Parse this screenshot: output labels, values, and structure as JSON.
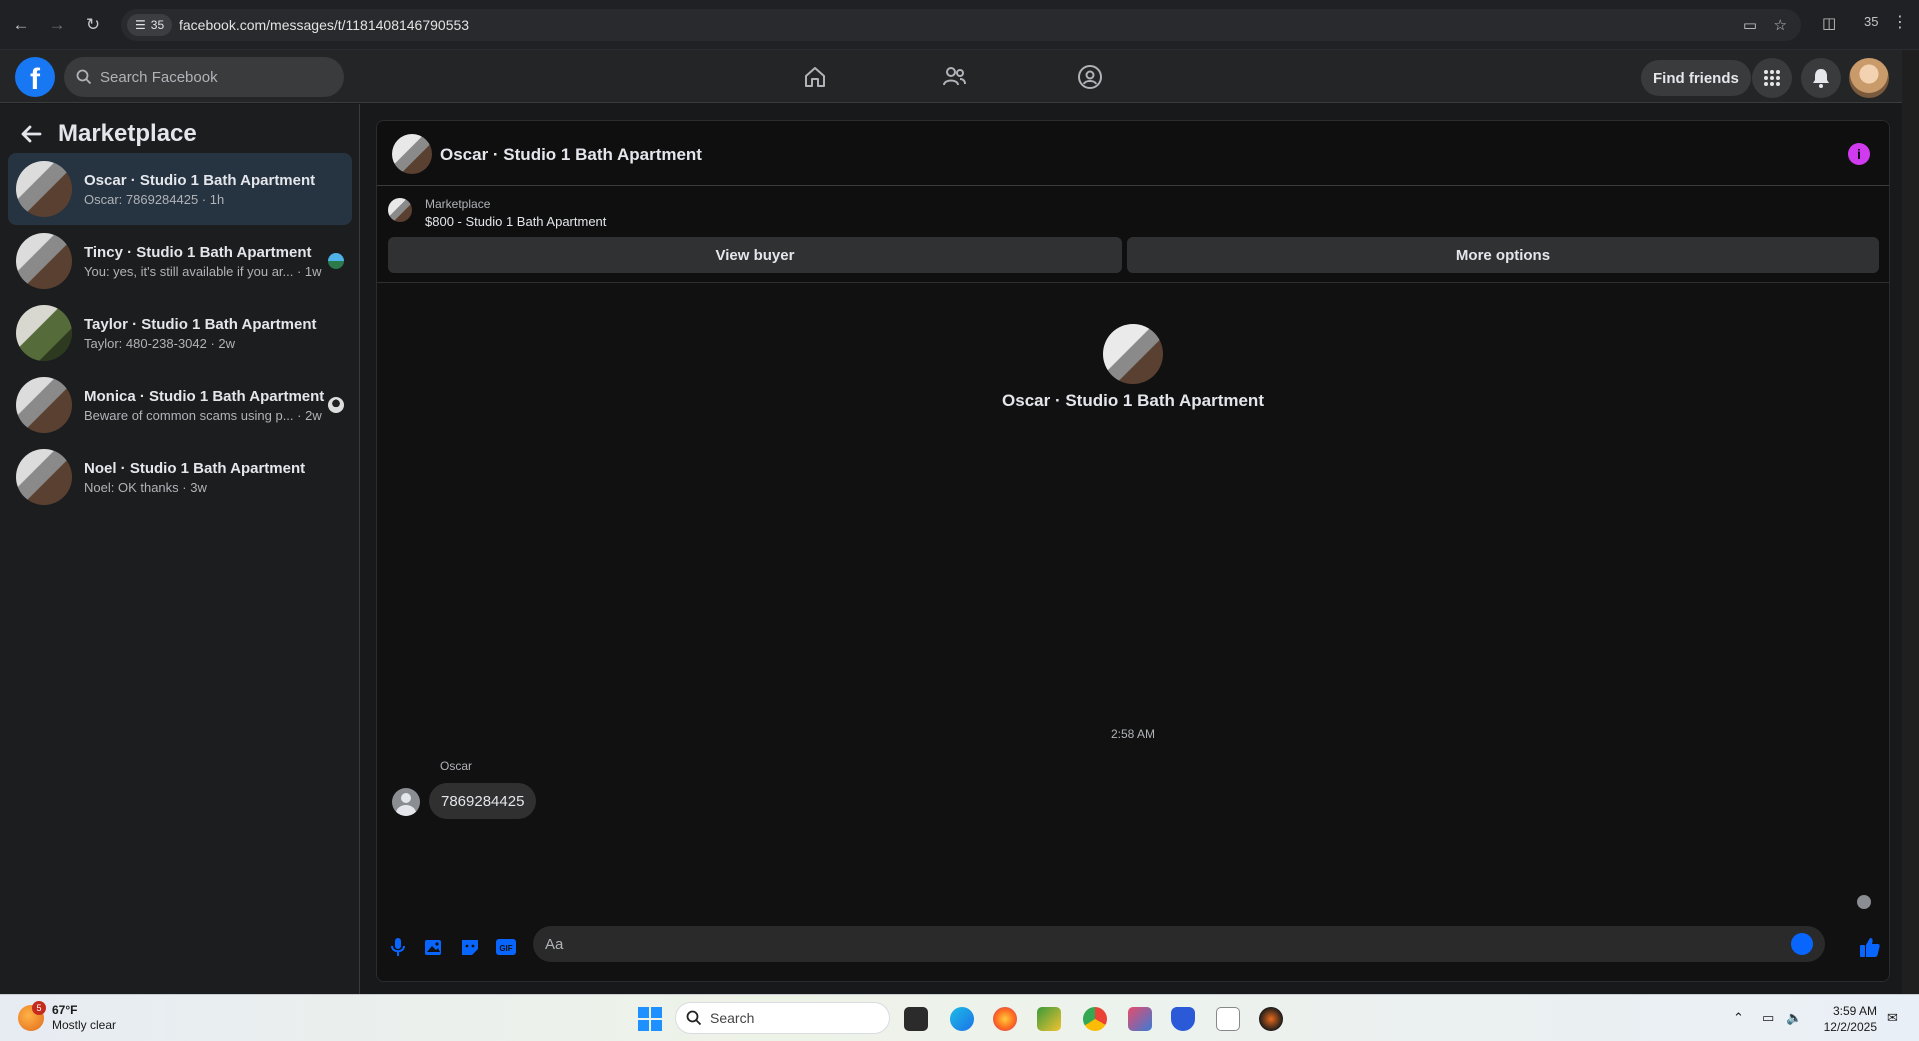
{
  "browser": {
    "tab_count": "35",
    "url": "facebook.com/messages/t/1181408146790553",
    "right_counter": "35"
  },
  "fb_nav": {
    "logo": "f",
    "search_placeholder": "Search Facebook",
    "find_friends": "Find friends"
  },
  "sidebar": {
    "title": "Marketplace",
    "conversations": [
      {
        "name": "Oscar · Studio 1 Bath Apartment",
        "preview": "Oscar: 7869284425 · 1h",
        "active": true
      },
      {
        "name": "Tincy · Studio 1 Bath Apartment",
        "preview": "You: yes, it's still available if you ar... · 1w"
      },
      {
        "name": "Taylor · Studio 1 Bath Apartment",
        "preview": "Taylor: 480-238-3042 · 2w"
      },
      {
        "name": "Monica · Studio 1 Bath Apartment",
        "preview": "Beware of common scams using p... · 2w"
      },
      {
        "name": "Noel · Studio 1 Bath Apartment",
        "preview": "Noel: OK thanks · 3w"
      }
    ]
  },
  "chat": {
    "title": "Oscar · Studio 1 Bath Apartment",
    "info_icon": "i",
    "listing_label": "Marketplace",
    "listing_price_title": "$800 - Studio 1 Bath Apartment",
    "view_buyer": "View buyer",
    "more_options": "More options",
    "intro_name": "Oscar · Studio 1 Bath Apartment",
    "timestamp": "2:58 AM",
    "sender": "Oscar",
    "message": "7869284425",
    "composer_placeholder": "Aa",
    "gif_label": "GIF"
  },
  "taskbar": {
    "weather_badge": "5",
    "weather_temp": "67°F",
    "weather_desc": "Mostly clear",
    "search_label": "Search",
    "time": "3:59 AM",
    "date": "12/2/2025"
  },
  "colors": {
    "accent": "#0866ff",
    "info": "#d13bf0",
    "facebook_blue": "#1877f2"
  }
}
